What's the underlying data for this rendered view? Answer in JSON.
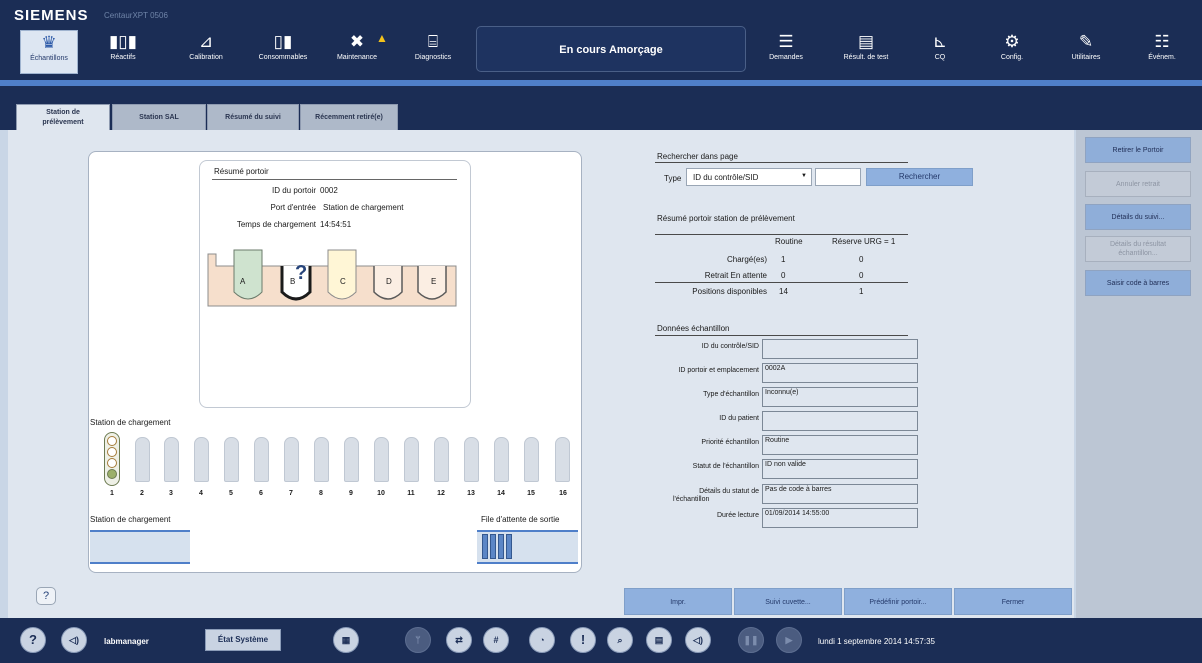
{
  "brand": "SIEMENS",
  "system_name": "CentaurXPT 0506",
  "nav_items": [
    {
      "label": "Échantillons",
      "icon": "samples-icon",
      "glyph": "♛",
      "active": true
    },
    {
      "label": "Réactifs",
      "icon": "reagents-icon",
      "glyph": "▮▯▮"
    },
    {
      "label": "Calibration",
      "icon": "calibration-icon",
      "glyph": "⊿"
    },
    {
      "label": "Consommables",
      "icon": "consumables-icon",
      "glyph": "▯▮"
    },
    {
      "label": "Maintenance",
      "icon": "maintenance-icon",
      "glyph": "✖"
    },
    {
      "label": "Diagnostics",
      "icon": "diagnostics-icon",
      "glyph": "⌸"
    },
    {
      "label": "Demandes",
      "icon": "requests-icon",
      "glyph": "☰"
    },
    {
      "label": "Résult. de test",
      "icon": "test-results-icon",
      "glyph": "▤"
    },
    {
      "label": "CQ",
      "icon": "qc-icon",
      "glyph": "⊾"
    },
    {
      "label": "Config.",
      "icon": "config-icon",
      "glyph": "⚙"
    },
    {
      "label": "Utilitaires",
      "icon": "utilities-icon",
      "glyph": "✎"
    },
    {
      "label": "Événem.",
      "icon": "events-icon",
      "glyph": "☷"
    }
  ],
  "status_text": "En cours Amorçage",
  "tabs": [
    {
      "label": "Station de prélèvement",
      "line1": "Station de",
      "line2": "prélèvement",
      "active": true
    },
    {
      "label": "Station SAL"
    },
    {
      "label": "Résumé du suivi"
    },
    {
      "label": "Récemment retiré(e)"
    }
  ],
  "rack_summary": {
    "title": "Résumé portoir",
    "rack_id_label": "ID du portoir",
    "rack_id": "0002",
    "entry_port_label": "Port d'entrée",
    "entry_port": "Station de chargement",
    "load_time_label": "Temps de chargement",
    "load_time": "14:54:51",
    "positions": [
      "A",
      "B",
      "C",
      "D",
      "E"
    ],
    "unknown_marker": "?"
  },
  "loading_station": {
    "title": "Station de chargement",
    "lanes": [
      "1",
      "2",
      "3",
      "4",
      "5",
      "6",
      "7",
      "8",
      "9",
      "10",
      "11",
      "12",
      "13",
      "14",
      "15",
      "16"
    ],
    "bottom_label": "Station de chargement",
    "exit_queue_label": "File d'attente de sortie"
  },
  "search": {
    "title": "Rechercher dans page",
    "type_label": "Type",
    "type_value": "ID du contrôle/SID",
    "input_value": "",
    "button": "Rechercher"
  },
  "station_summary": {
    "title": "Résumé portoir station de prélèvement",
    "col_routine": "Routine",
    "col_urg": "Réserve URG = 1",
    "rows": [
      {
        "label": "Chargé(es)",
        "routine": "1",
        "urg": "0"
      },
      {
        "label": "Retrait En attente",
        "routine": "0",
        "urg": "0"
      },
      {
        "label": "Positions disponibles",
        "routine": "14",
        "urg": "1"
      }
    ]
  },
  "sample_data": {
    "title": "Données échantillon",
    "fields": [
      {
        "label": "ID du contrôle/SID",
        "value": ""
      },
      {
        "label": "ID portoir et emplacement",
        "value": "0002A"
      },
      {
        "label": "Type d'échantillon",
        "value": "Inconnu(e)"
      },
      {
        "label": "ID du patient",
        "value": ""
      },
      {
        "label": "Priorité échantillon",
        "value": "Routine"
      },
      {
        "label": "Statut de l'échantillon",
        "value": "ID non valide"
      },
      {
        "label": "Détails du statut de l'échantillon",
        "label_line1": "Détails du statut de",
        "label_line2": "l'échantillon",
        "value": "Pas de code à barres"
      },
      {
        "label": "Durée lecture",
        "value": "01/09/2014 14:55:00"
      }
    ]
  },
  "right_buttons": [
    {
      "label": "Retirer le Portoir",
      "enabled": true
    },
    {
      "label": "Annuler retrait",
      "enabled": false
    },
    {
      "label": "Détails du suivi...",
      "enabled": true
    },
    {
      "label": "Détails du résultat échantillon...",
      "line1": "Détails du résultat",
      "line2": "échantillon...",
      "enabled": false
    },
    {
      "label": "Saisir code à barres",
      "enabled": true
    }
  ],
  "help_label": "?",
  "bottom_buttons": [
    "Impr.",
    "Suivi cuvette...",
    "Prédéfinir portoir...",
    "Fermer"
  ],
  "footer": {
    "user": "labmanager",
    "system_status": "État Système",
    "datetime": "lundi 1 septembre 2014 14:57:35",
    "help_glyph": "?",
    "alert_glyph": "!"
  }
}
